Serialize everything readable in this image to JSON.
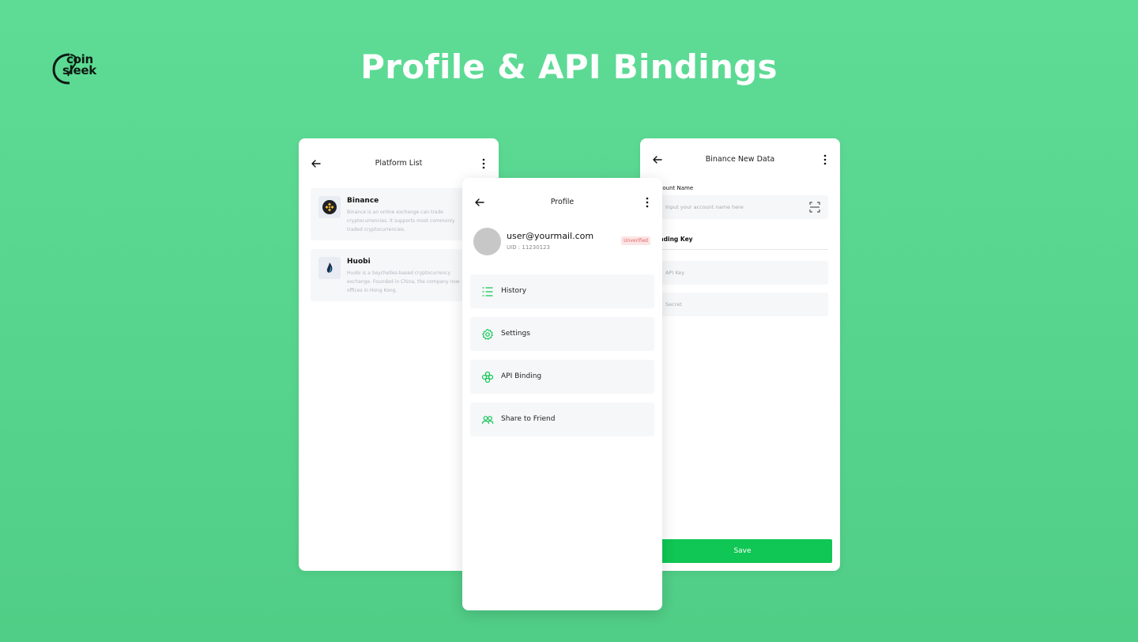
{
  "brand": {
    "name_line1": "coin",
    "name_line2": "sleek",
    "color": "#0e1a12"
  },
  "hero": {
    "title": "Profile & API Bindings"
  },
  "colors": {
    "background": "#5adb93",
    "accent": "#10c654",
    "badge_bg": "#fde4e4",
    "badge_text": "#e06666"
  },
  "platform_list": {
    "title": "Platform List",
    "items": [
      {
        "name": "Binance",
        "icon": "binance-logo",
        "description": "Binance is an online exchange can trade cryptocurrencies. It supports most commonly traded cryptocurrencies."
      },
      {
        "name": "Huobi",
        "icon": "huobi-logo",
        "description": "Huobi is a Seychelles-based cryptocurrency exchange. Founded in China, the company now offices in Hong Kong."
      }
    ]
  },
  "profile": {
    "title": "Profile",
    "email": "user@yourmail.com",
    "uid": "UID : 11230123",
    "status": "Unverified",
    "menu": [
      {
        "label": "History",
        "icon": "list-icon"
      },
      {
        "label": "Settings",
        "icon": "gear-icon"
      },
      {
        "label": "API Binding",
        "icon": "link-icon"
      },
      {
        "label": "Share to Friend",
        "icon": "users-icon"
      }
    ]
  },
  "binance_form": {
    "title": "Binance New Data",
    "account_label": "Account Name",
    "account_placeholder": "Input your account name here",
    "binding_label": "Binding Key",
    "api_key_placeholder": "API Key",
    "secret_placeholder": "Secret",
    "save_label": "Save"
  }
}
